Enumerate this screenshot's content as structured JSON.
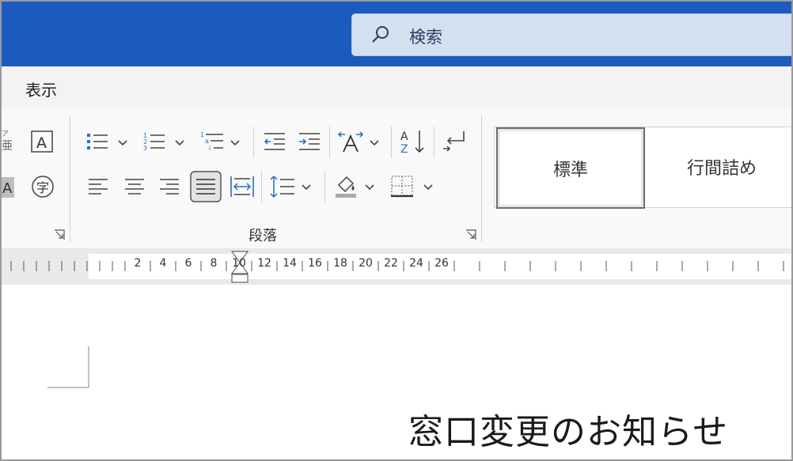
{
  "search": {
    "placeholder": "検索"
  },
  "menu": {
    "items": [
      {
        "label": "表示"
      }
    ]
  },
  "paragraph_group": {
    "label": "段落"
  },
  "styles": [
    {
      "label": "標準",
      "selected": true
    },
    {
      "label": "行間詰め",
      "selected": false
    }
  ],
  "ruler": {
    "numbers": [
      "2",
      "4",
      "6",
      "8",
      "10",
      "12",
      "14",
      "16",
      "18",
      "20",
      "22",
      "24",
      "26"
    ]
  },
  "document": {
    "title_text": "窓口変更のお知らせ"
  },
  "colors": {
    "titlebar": "#1b5bbd",
    "search_bg": "#d4dff0",
    "accent_blue": "#2b6cc4"
  }
}
